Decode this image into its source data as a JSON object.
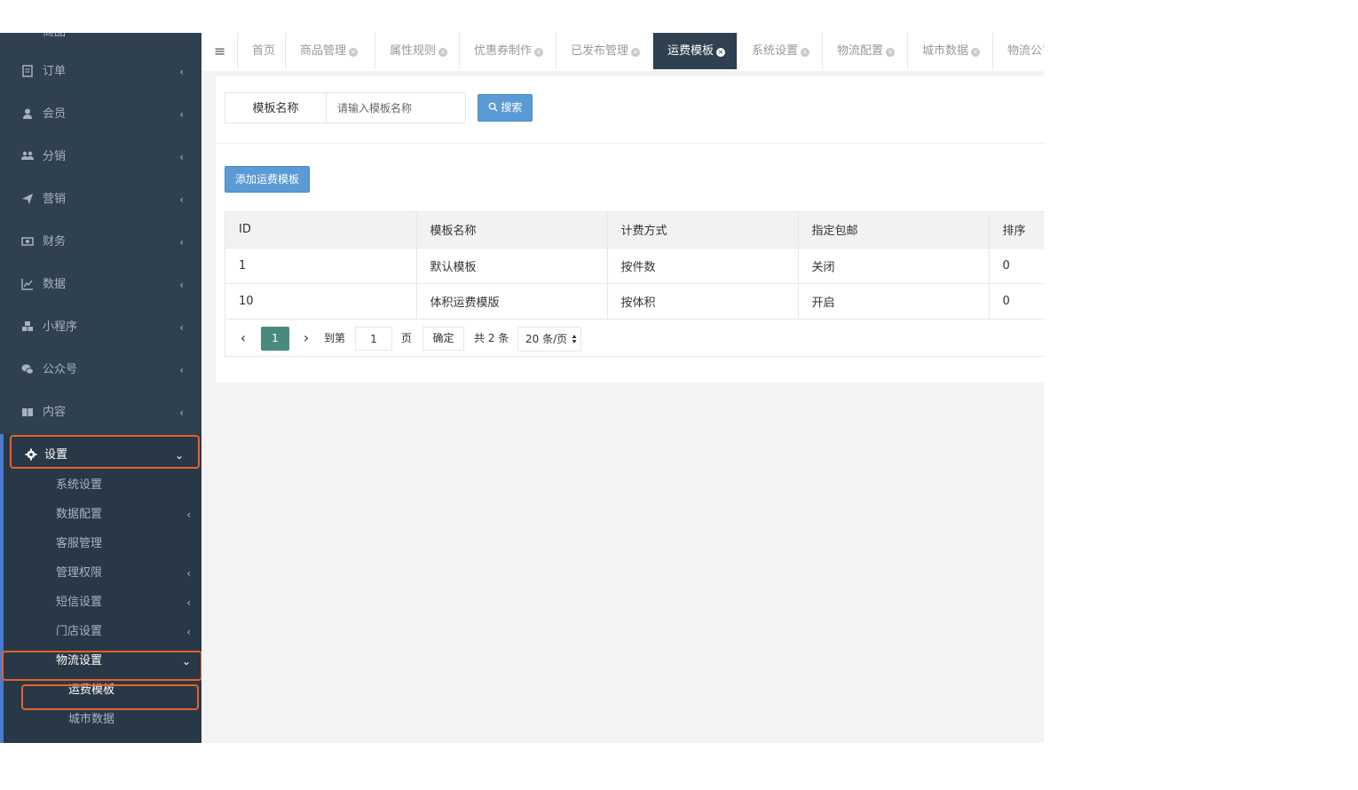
{
  "sidebar": {
    "top_partial": "商品",
    "items": [
      {
        "label": "订单",
        "icon": "receipt-icon"
      },
      {
        "label": "会员",
        "icon": "user-icon"
      },
      {
        "label": "分销",
        "icon": "users-icon"
      },
      {
        "label": "营销",
        "icon": "paper-plane-icon"
      },
      {
        "label": "财务",
        "icon": "money-icon"
      },
      {
        "label": "数据",
        "icon": "line-chart-icon"
      },
      {
        "label": "小程序",
        "icon": "cubes-icon"
      },
      {
        "label": "公众号",
        "icon": "wechat-icon"
      },
      {
        "label": "内容",
        "icon": "book-icon"
      },
      {
        "label": "设置",
        "icon": "gear-icon"
      }
    ],
    "sub_items": [
      {
        "label": "系统设置"
      },
      {
        "label": "数据配置"
      },
      {
        "label": "客服管理"
      },
      {
        "label": "管理权限"
      },
      {
        "label": "短信设置"
      },
      {
        "label": "门店设置"
      },
      {
        "label": "物流设置"
      }
    ],
    "sub_sub_items": [
      {
        "label": "运费模板"
      },
      {
        "label": "城市数据"
      }
    ],
    "chevron_left": "‹",
    "chevron_down": "⌄"
  },
  "tabs": {
    "menu_icon": "≡",
    "close_glyph": "×",
    "home": "首页",
    "items": [
      {
        "label": "商品管理"
      },
      {
        "label": "属性规则"
      },
      {
        "label": "优惠券制作"
      },
      {
        "label": "已发布管理"
      },
      {
        "label": "运费模板"
      },
      {
        "label": "系统设置"
      },
      {
        "label": "物流配置"
      },
      {
        "label": "城市数据"
      },
      {
        "label": "物流公司"
      }
    ]
  },
  "search": {
    "label": "模板名称",
    "placeholder": "请输入模板名称",
    "button_label": "搜索",
    "button_icon": "🔍"
  },
  "toolbar": {
    "add_label": "添加运费模板"
  },
  "table": {
    "headers": [
      "ID",
      "模板名称",
      "计费方式",
      "指定包邮",
      "排序"
    ],
    "rows": [
      [
        "1",
        "默认模板",
        "按件数",
        "关闭",
        "0"
      ],
      [
        "10",
        "体积运费模版",
        "按体积",
        "开启",
        "0"
      ]
    ]
  },
  "pagination": {
    "prev": "‹",
    "next": "›",
    "current_page": "1",
    "goto_label": "到第",
    "goto_value": "1",
    "page_unit": "页",
    "confirm_label": "确定",
    "total_label": "共 2 条",
    "page_size": "20 条/页",
    "select_arrows": "▲▼"
  },
  "colors": {
    "sidebar_bg": "#2f4050",
    "accent": "#5b9bd5",
    "highlight": "#e8622c",
    "pager_active": "#4a8a7e"
  }
}
